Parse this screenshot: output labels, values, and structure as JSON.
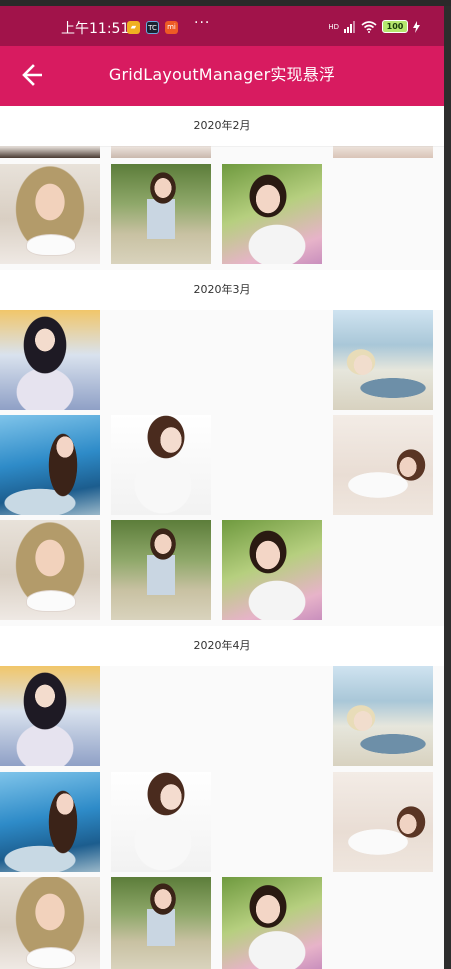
{
  "status_bar": {
    "time": "上午11:51",
    "app_icons": [
      "chat-bubble-icon",
      "tc-app-icon",
      "mi-app-icon"
    ],
    "more": "···",
    "signal_label": "HD",
    "battery_level": "100",
    "background": "#a1134a"
  },
  "toolbar": {
    "title": "GridLayoutManager实现悬浮",
    "back_icon": "arrow-left-icon",
    "background": "#d81b60"
  },
  "sections": [
    {
      "label": "2020年2月"
    },
    {
      "label": "2020年3月"
    },
    {
      "label": "2020年4月"
    }
  ]
}
